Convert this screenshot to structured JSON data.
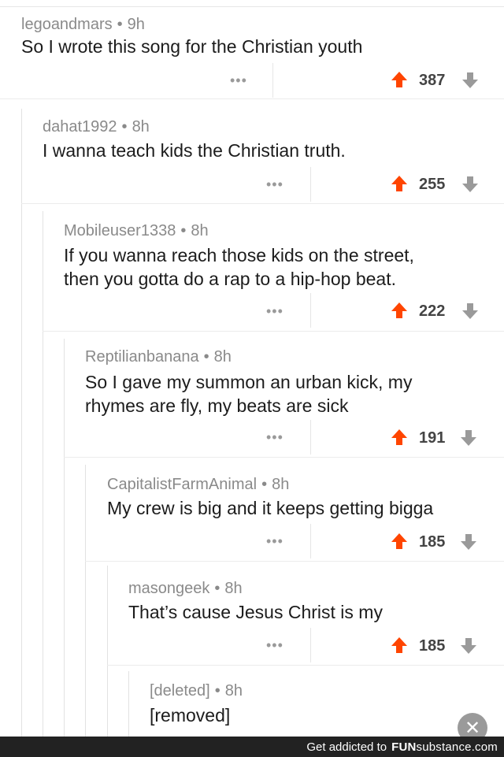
{
  "comments": [
    {
      "author": "legoandmars",
      "age": "9h",
      "text": "So I wrote this song for the Christian youth",
      "more": "•••",
      "score": "387"
    },
    {
      "author": "dahat1992",
      "age": "8h",
      "text": "I wanna teach kids the Christian truth.",
      "more": "•••",
      "score": "255"
    },
    {
      "author": "Mobileuser1338",
      "age": "8h",
      "text": "If you wanna reach those kids on the street,\nthen you gotta do a rap to a hip-hop beat.",
      "more": "•••",
      "score": "222"
    },
    {
      "author": "Reptilianbanana",
      "age": "8h",
      "text": "So I gave my summon an urban kick, my\nrhymes are fly, my beats are sick",
      "more": "•••",
      "score": "191"
    },
    {
      "author": "CapitalistFarmAnimal",
      "age": "8h",
      "text": "My crew is big and it keeps getting bigga",
      "more": "•••",
      "score": "185"
    },
    {
      "author": "masongeek",
      "age": "8h",
      "text": "That’s cause Jesus Christ is my",
      "more": "•••",
      "score": "185"
    },
    {
      "author": "[deleted]",
      "age": "8h",
      "text": "[removed]"
    }
  ],
  "separator": "•",
  "colors": {
    "upvote": "#ff4500",
    "downvote": "#9a9a9a",
    "footer_bg": "#222222"
  },
  "footer": {
    "text": "Get addicted to",
    "brand_fun": "FUN",
    "brand_sub": "substance.com"
  },
  "close_symbol": "✕"
}
